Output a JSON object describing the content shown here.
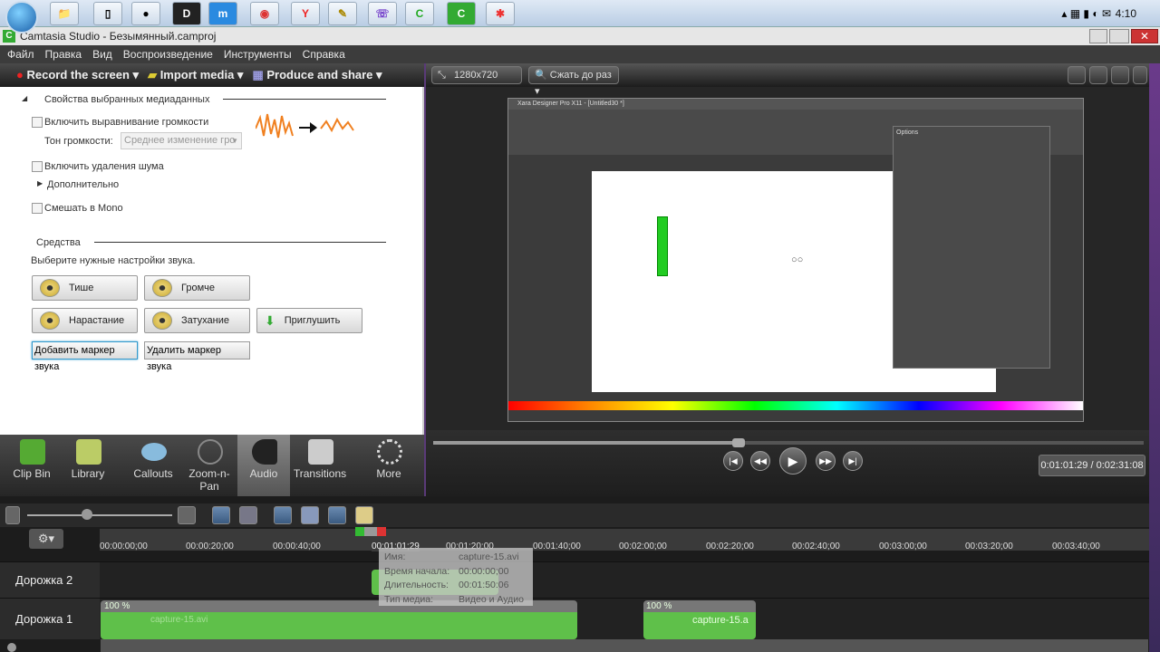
{
  "taskbar": {
    "clock": "4:10",
    "apps": [
      "Explorer",
      "Notes",
      "OBS",
      "D",
      "Maxthon",
      "Chrome",
      "Yandex",
      "Tool",
      "Viber",
      "Camtasia",
      "Camtasia Recorder",
      "Huawei"
    ],
    "app_glyphs": [
      "📁",
      "▯",
      "●",
      "D",
      "m",
      "◉",
      "Y",
      "✎",
      "☏",
      "C",
      "C",
      "✱"
    ]
  },
  "window": {
    "title": "Camtasia Studio - Безымянный.camproj"
  },
  "menu": [
    "Файл",
    "Правка",
    "Вид",
    "Воспроизведение",
    "Инструменты",
    "Справка"
  ],
  "toolbar": {
    "record": "Record the screen ▾",
    "import": "Import media ▾",
    "produce": "Produce and share ▾"
  },
  "audio_panel": {
    "section_title": "Свойства выбранных медиаданных",
    "leveling_label": "Включить выравнивание громкости",
    "volume_tone_label": "Тон громкости:",
    "volume_tone_value": "Среднее изменение гро",
    "noise_label": "Включить удаления шума",
    "advanced_label": "Дополнительно",
    "mono_label": "Смешать в Mono",
    "tools_title": "Средства",
    "tools_hint": "Выберите нужные настройки звука.",
    "buttons": {
      "quieter": "Тише",
      "louder": "Громче",
      "fade_in": "Нарастание",
      "fade_out": "Затухание",
      "silence": "Приглушить",
      "add_marker": "Добавить маркер звука",
      "remove_marker": "Удалить маркер звука"
    }
  },
  "tabs": [
    "Clip Bin",
    "Library",
    "Callouts",
    "Zoom-n-Pan",
    "Audio",
    "Transitions",
    "More"
  ],
  "active_tab": "Audio",
  "preview": {
    "dimensions": "1280x720",
    "zoom": "Сжать до раз",
    "embedded_title": "Xara Designer Pro X11 - [Untitled30 *]",
    "embedded_dialog": "Options",
    "time": "0:01:01:29 / 0:02:31:08",
    "progress": 0.43
  },
  "timeline": {
    "ruler": [
      "00:00:00;00",
      "00:00:20;00",
      "00:00:40;00",
      "00:01:20;00",
      "00:01:40;00",
      "00:02:00;00",
      "00:02:20;00",
      "00:02:40;00",
      "00:03:00;00",
      "00:03:20;00",
      "00:03:40;00"
    ],
    "playhead": "00:01:01;29",
    "tracks": [
      "Дорожка 2",
      "Дорожка 1"
    ],
    "clips": [
      {
        "name": "capture-15.avi",
        "volume": "100 %"
      },
      {
        "name": "capture-15.a",
        "volume": "100 %"
      }
    ],
    "tooltip": {
      "name_label": "Имя:",
      "name": "capture-15.avi",
      "start_label": "Время начала:",
      "start": "00:00:00;00",
      "duration_label": "Длительность:",
      "duration": "00:01:50:06",
      "type_label": "Тип медиа:",
      "type": "Видео и Аудио"
    }
  }
}
